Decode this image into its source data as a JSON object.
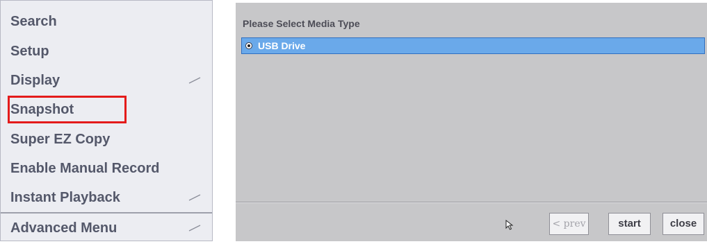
{
  "menu": {
    "items": [
      {
        "label": "Search",
        "has_arrow": false
      },
      {
        "label": "Setup",
        "has_arrow": false
      },
      {
        "label": "Display",
        "has_arrow": true
      },
      {
        "label": "Snapshot",
        "has_arrow": false,
        "highlighted": true
      },
      {
        "label": "Super  EZ  Copy",
        "has_arrow": false
      },
      {
        "label": "Enable  Manual  Record",
        "has_arrow": false
      },
      {
        "label": "Instant  Playback",
        "has_arrow": true
      }
    ],
    "footer_item": {
      "label": "Advanced  Menu",
      "has_arrow": true
    },
    "highlight_color": "#e41b1b"
  },
  "panel": {
    "title": "Please  Select  Media  Type",
    "media_options": [
      {
        "label": "USB  Drive",
        "selected": true
      }
    ],
    "selection_color": "#6aa9ea",
    "buttons": {
      "prev": {
        "label": "< prev",
        "enabled": false
      },
      "start": {
        "label": "start",
        "enabled": true
      },
      "close": {
        "label": "close",
        "enabled": true
      }
    }
  },
  "icons": [
    "submenu-arrow-icon",
    "radio-selected-icon",
    "mouse-cursor-icon"
  ]
}
